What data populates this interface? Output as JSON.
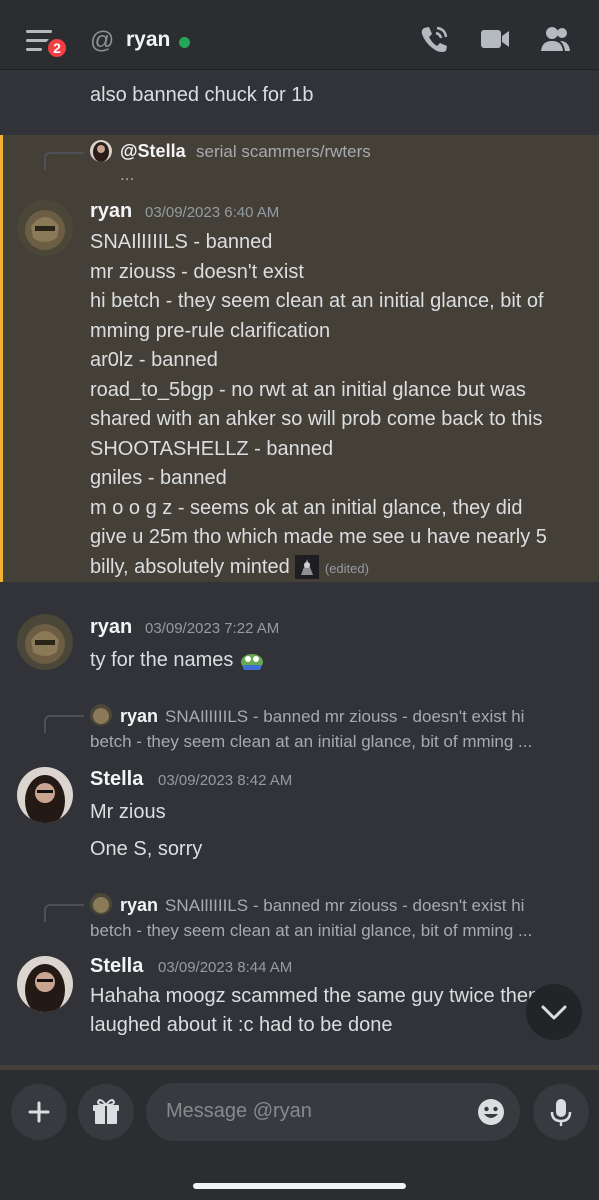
{
  "header": {
    "notification_count": "2",
    "at_symbol": "@",
    "channel_name": "ryan",
    "icons": [
      "menu-icon",
      "voice-call-icon",
      "video-call-icon",
      "member-list-icon"
    ]
  },
  "messages": {
    "m0": {
      "text": "also banned chuck for 1b"
    },
    "m1": {
      "reply_author": "@Stella",
      "reply_snippet": "serial scammers/rwters",
      "reply_more": "...",
      "author": "ryan",
      "timestamp": "03/09/2023 6:40 AM",
      "lines": [
        "SNAIlIIIILS - banned",
        "mr ziouss - doesn't exist",
        "hi betch - they seem clean at an initial glance, bit of",
        "mming pre-rule clarification",
        "ar0lz - banned",
        "road_to_5bgp - no rwt at an initial glance but was",
        "shared with an ahker so will prob come back to this",
        "SHOOTASHELLZ - banned",
        "gniles - banned",
        "m o o g z - seems ok at an initial glance, they did",
        "give u 25m tho which made me see u have nearly 5",
        "billy, absolutely minted"
      ],
      "edited": "(edited)"
    },
    "m2": {
      "author": "ryan",
      "timestamp": "03/09/2023 7:22 AM",
      "text": "ty for the names"
    },
    "m3": {
      "reply_author": "ryan",
      "reply_line1": "SNAIlIIIILS - banned mr ziouss - doesn't exist hi",
      "reply_line2": "betch - they seem clean at an initial glance, bit of mming ...",
      "author": "Stella",
      "timestamp": "03/09/2023 8:42 AM",
      "line1": "Mr zious",
      "line2": "One S, sorry"
    },
    "m4": {
      "reply_author": "ryan",
      "reply_line1": "SNAIlIIIILS - banned mr ziouss - doesn't exist hi",
      "reply_line2": "betch - they seem clean at an initial glance, bit of mming ...",
      "author": "Stella",
      "timestamp": "03/09/2023 8:44 AM",
      "line1": "Hahaha moogz scammed the same guy twice then",
      "line2": "laughed about it :c had to be done"
    }
  },
  "composer": {
    "placeholder": "Message @ryan"
  },
  "colors": {
    "background": "#313338",
    "header": "#2b2d31",
    "mention_highlight": "#444037",
    "mention_bar": "#f0b232",
    "online": "#23a55a",
    "badge": "#f23f43"
  }
}
